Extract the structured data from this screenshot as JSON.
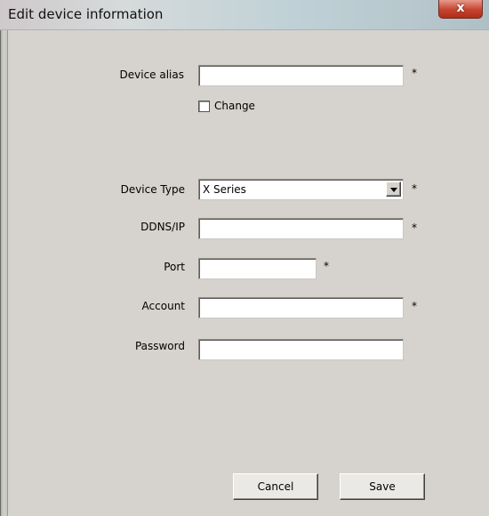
{
  "window": {
    "title": "Edit device information",
    "close_glyph": "x"
  },
  "form": {
    "device_alias": {
      "label": "Device alias",
      "value": "",
      "required_mark": "*"
    },
    "change": {
      "label": "Change",
      "checked": false
    },
    "device_type": {
      "label": "Device Type",
      "selected": "X Series",
      "required_mark": "*"
    },
    "ddns_ip": {
      "label": "DDNS/IP",
      "value": "",
      "required_mark": "*"
    },
    "port": {
      "label": "Port",
      "value": "",
      "required_mark": "*"
    },
    "account": {
      "label": "Account",
      "value": "",
      "required_mark": "*"
    },
    "password": {
      "label": "Password",
      "value": ""
    }
  },
  "buttons": {
    "cancel": "Cancel",
    "save": "Save"
  },
  "icons": {
    "close": "close-icon",
    "dropdown": "chevron-down-icon"
  }
}
